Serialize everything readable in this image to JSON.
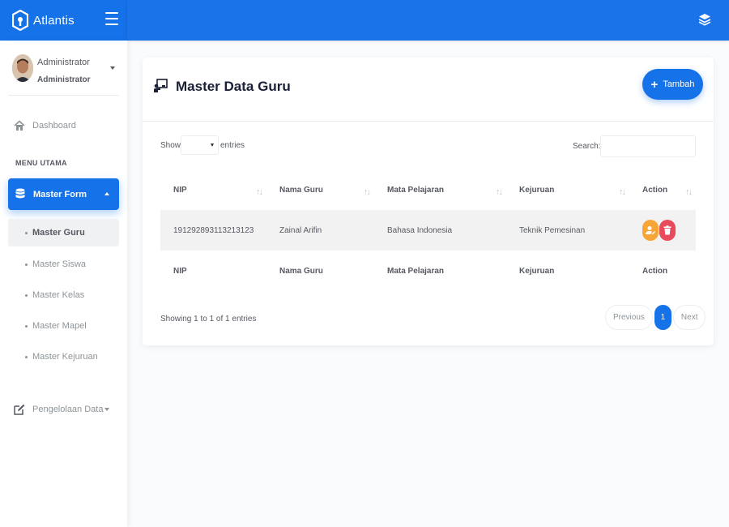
{
  "brand": {
    "name": "Atlantis",
    "primary_color": "#1572e8"
  },
  "header": {
    "menu_icon": "hamburger-icon",
    "right_icon": "layers-icon"
  },
  "user": {
    "name": "Administrator",
    "role": "Administrator"
  },
  "sidebar": {
    "dashboard": "Dashboard",
    "section_title": "MENU UTAMA",
    "master_form": "Master Form",
    "sub_items": [
      {
        "label": "Master Guru"
      },
      {
        "label": "Master Siswa"
      },
      {
        "label": "Master Kelas"
      },
      {
        "label": "Master Mapel"
      },
      {
        "label": "Master Kejuruan"
      }
    ],
    "pengelolaan": "Pengelolaan Data"
  },
  "card": {
    "title": "Master Data Guru",
    "add_button": "Tambah"
  },
  "table_controls": {
    "show": "Show",
    "entries": "entries",
    "search": "Search:"
  },
  "table": {
    "columns": [
      "NIP",
      "Nama Guru",
      "Mata Pelajaran",
      "Kejuruan",
      "Action"
    ],
    "rows": [
      {
        "nip": "191292893113213123",
        "nama": "Zainal Arifin",
        "mapel": "Bahasa Indonesia",
        "kejuruan": "Teknik Pemesinan"
      }
    ]
  },
  "footer": {
    "info": "Showing 1 to 1 of 1 entries",
    "previous": "Previous",
    "page": "1",
    "next": "Next"
  },
  "colors": {
    "edit_button": "#f7a536",
    "delete_button": "#e84c5c"
  }
}
